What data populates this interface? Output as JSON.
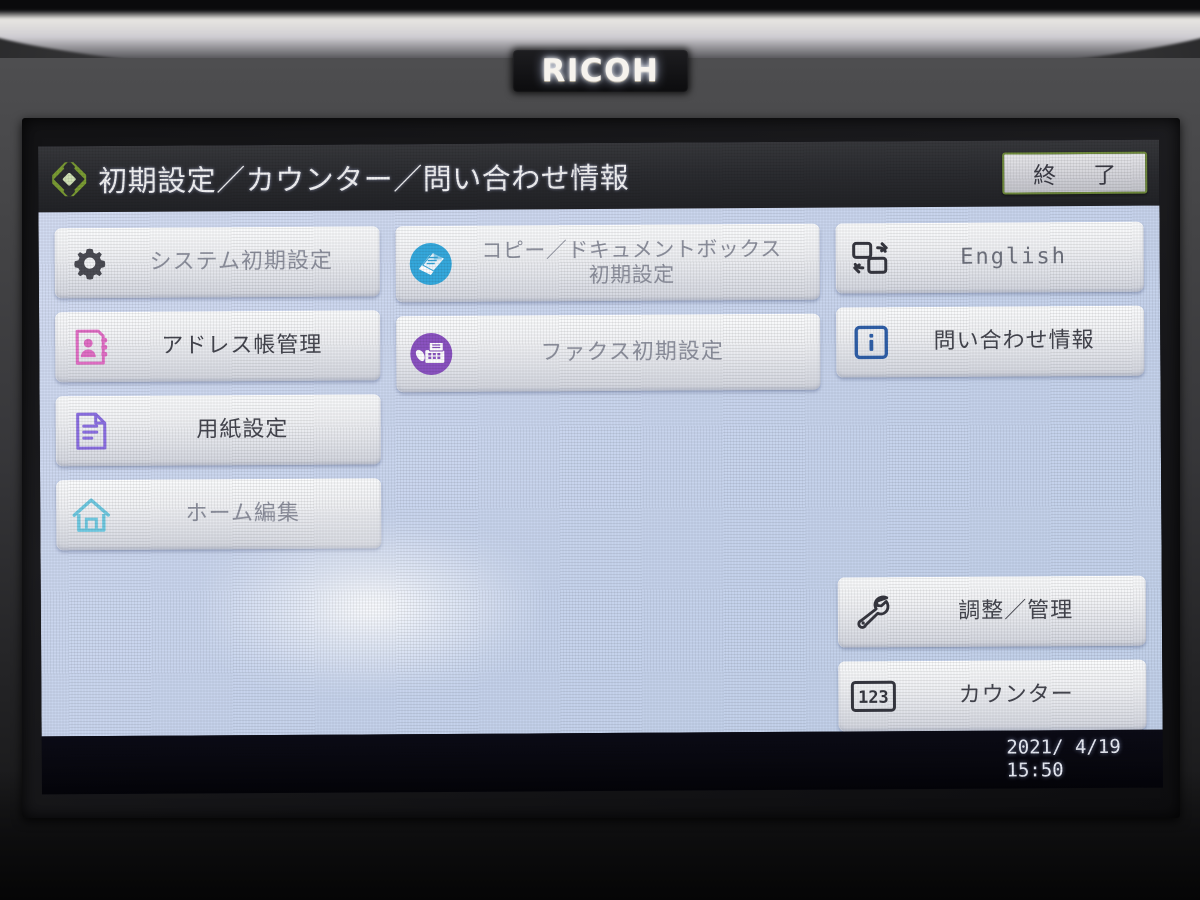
{
  "device": {
    "brand": "RICOH"
  },
  "header": {
    "icon": "settings-diamond-icon",
    "title": "初期設定／カウンター／問い合わせ情報",
    "exit_label": "終　了"
  },
  "panel": {
    "left_column": [
      {
        "icon": "gear-icon",
        "label": "システム初期設定",
        "dim": true
      },
      {
        "icon": "address-book-icon",
        "label": "アドレス帳管理",
        "dim": false
      },
      {
        "icon": "paper-document-icon",
        "label": "用紙設定",
        "dim": false
      },
      {
        "icon": "home-icon",
        "label": "ホーム編集",
        "dim": true
      }
    ],
    "mid_column": [
      {
        "icon": "copy-docbox-icon",
        "label_line1": "コピー／ドキュメントボックス",
        "label_line2": "初期設定",
        "dim": true
      },
      {
        "icon": "fax-icon",
        "label_line1": "ファクス初期設定",
        "label_line2": "",
        "dim": true
      }
    ],
    "right_column_top": [
      {
        "icon": "language-switch-icon",
        "label": "English",
        "latin": true,
        "dim": true
      },
      {
        "icon": "info-icon",
        "label": "問い合わせ情報",
        "latin": false,
        "dim": false
      }
    ],
    "right_column_bottom": [
      {
        "icon": "wrench-icon",
        "label": "調整／管理"
      },
      {
        "icon": "counter-123-icon",
        "label": "カウンター"
      }
    ]
  },
  "status": {
    "date": "2021/ 4/19",
    "time": "15:50"
  },
  "colors": {
    "panel_bg": "#ccd7ef",
    "titlebar_bg": "#2b2c30",
    "exit_border": "#6f8a3c",
    "accent_gear": "#4a4b53",
    "accent_addressbook": "#e06ec4",
    "accent_paper": "#8a6ee0",
    "accent_home": "#6fc8e0",
    "accent_copy": "#35a8dc",
    "accent_fax": "#8a52c0",
    "accent_info": "#2f5fa8",
    "accent_text": "#44454e"
  }
}
